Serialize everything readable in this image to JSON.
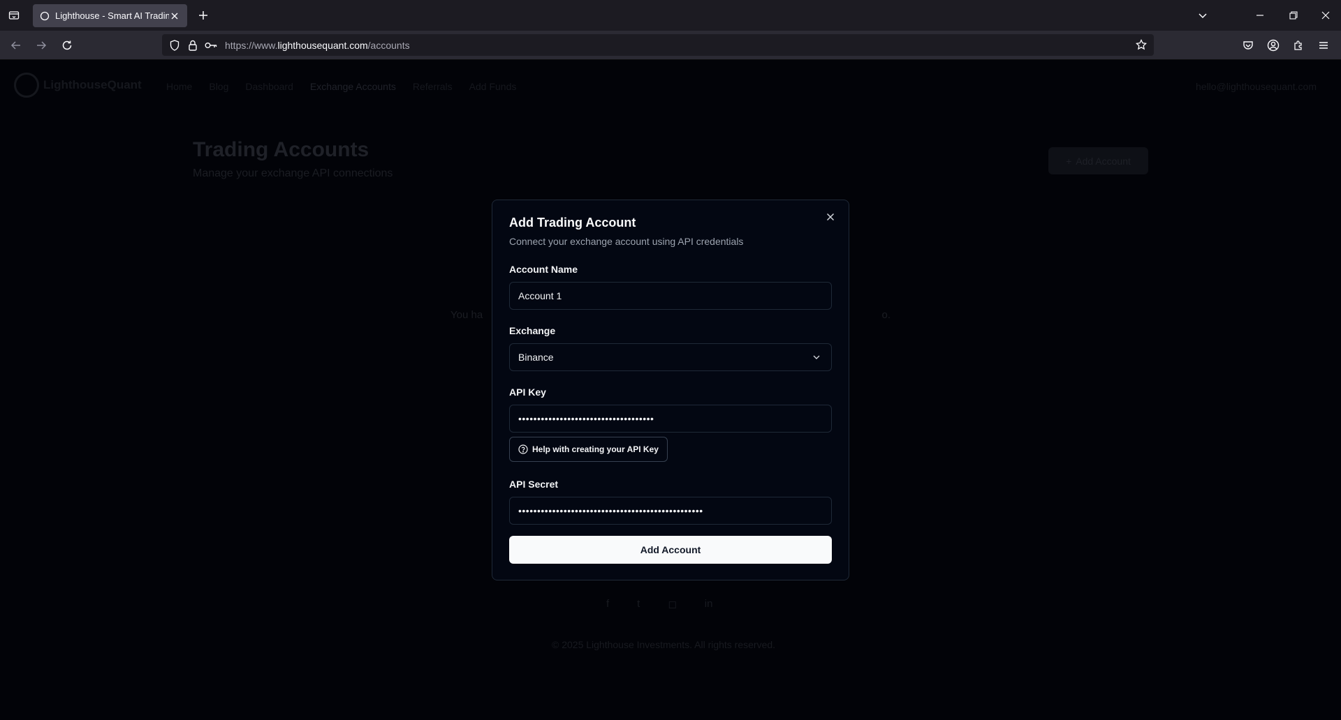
{
  "browser": {
    "tab_title": "Lighthouse - Smart AI Trading",
    "url_prefix": "https://www.",
    "url_domain": "lighthousequant.com",
    "url_path": "/accounts"
  },
  "site": {
    "brand": "LighthouseQuant",
    "nav": [
      "Home",
      "Blog",
      "Dashboard",
      "Exchange Accounts",
      "Referrals",
      "Add Funds"
    ],
    "active_nav": "Exchange Accounts",
    "user_email": "hello@lighthousequant.com",
    "page_title": "Trading Accounts",
    "page_subtitle": "Manage your exchange API connections",
    "add_button": "Add Account",
    "empty_left": "You ha",
    "empty_right": "o.",
    "copyright": "© 2025 Lighthouse Investments. All rights reserved."
  },
  "modal": {
    "title": "Add Trading Account",
    "description": "Connect your exchange account using API credentials",
    "account_name_label": "Account Name",
    "account_name_value": "Account 1",
    "exchange_label": "Exchange",
    "exchange_value": "Binance",
    "api_key_label": "API Key",
    "api_key_masked": "••••••••••••••••••••••••••••••••••••",
    "help_label": "Help with creating your API Key",
    "api_secret_label": "API Secret",
    "api_secret_masked": "•••••••••••••••••••••••••••••••••••••••••••••••••",
    "submit_label": "Add Account"
  }
}
